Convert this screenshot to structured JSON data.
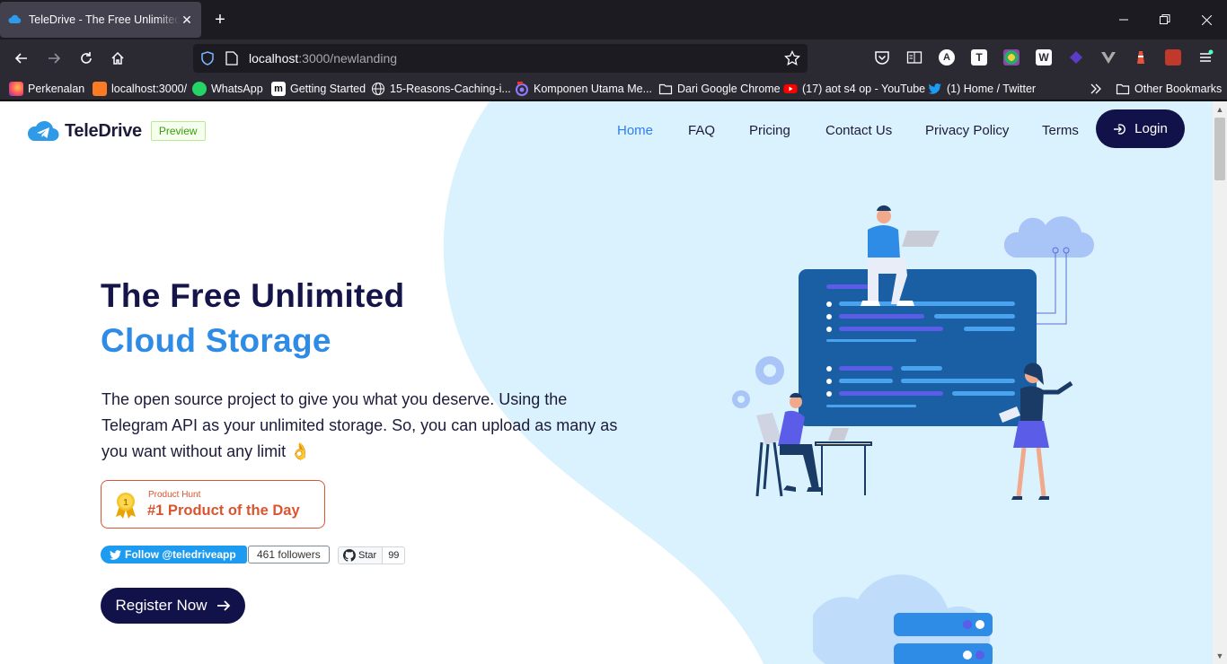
{
  "browser": {
    "tab_title": "TeleDrive - The Free Unlimited Cloud Storage",
    "url_host": "localhost",
    "url_path": ":3000/newlanding",
    "bookmarks": [
      {
        "label": "Perkenalan",
        "icon": "firefox-icon"
      },
      {
        "label": "localhost:3000/",
        "icon": "xampp-icon"
      },
      {
        "label": "WhatsApp",
        "icon": "whatsapp-icon"
      },
      {
        "label": "Getting Started",
        "icon": "m-icon"
      },
      {
        "label": "15-Reasons-Caching-i...",
        "icon": "globe-icon"
      },
      {
        "label": "Komponen Utama Me...",
        "icon": "target-icon"
      },
      {
        "label": "Dari Google Chrome",
        "icon": "folder-icon"
      },
      {
        "label": "(17) aot s4 op - YouTube",
        "icon": "youtube-icon"
      },
      {
        "label": "(1) Home / Twitter",
        "icon": "twitter-icon"
      }
    ],
    "other_bookmarks": "Other Bookmarks"
  },
  "header": {
    "brand": "TeleDrive",
    "badge": "Preview",
    "nav": [
      "Home",
      "FAQ",
      "Pricing",
      "Contact Us",
      "Privacy Policy",
      "Terms"
    ],
    "active_nav": "Home",
    "login": "Login"
  },
  "hero": {
    "title_line1": "The Free Unlimited",
    "title_line2": "Cloud Storage",
    "lead": "The open source project to give you what you deserve. Using the Telegram API as your unlimited storage. So, you can upload as many as you want without any limit 👌",
    "producthunt_small": "Product Hunt",
    "producthunt_big": "#1 Product of the Day",
    "producthunt_rank": "1",
    "twitter_follow": "Follow @teledriveapp",
    "twitter_followers": "461 followers",
    "github_star": "Star",
    "github_count": "99",
    "register": "Register Now"
  },
  "colors": {
    "navy": "#12124a",
    "accent_blue": "#2e8be6",
    "light_bg": "#daf1fe",
    "producthunt": "#da552f"
  }
}
